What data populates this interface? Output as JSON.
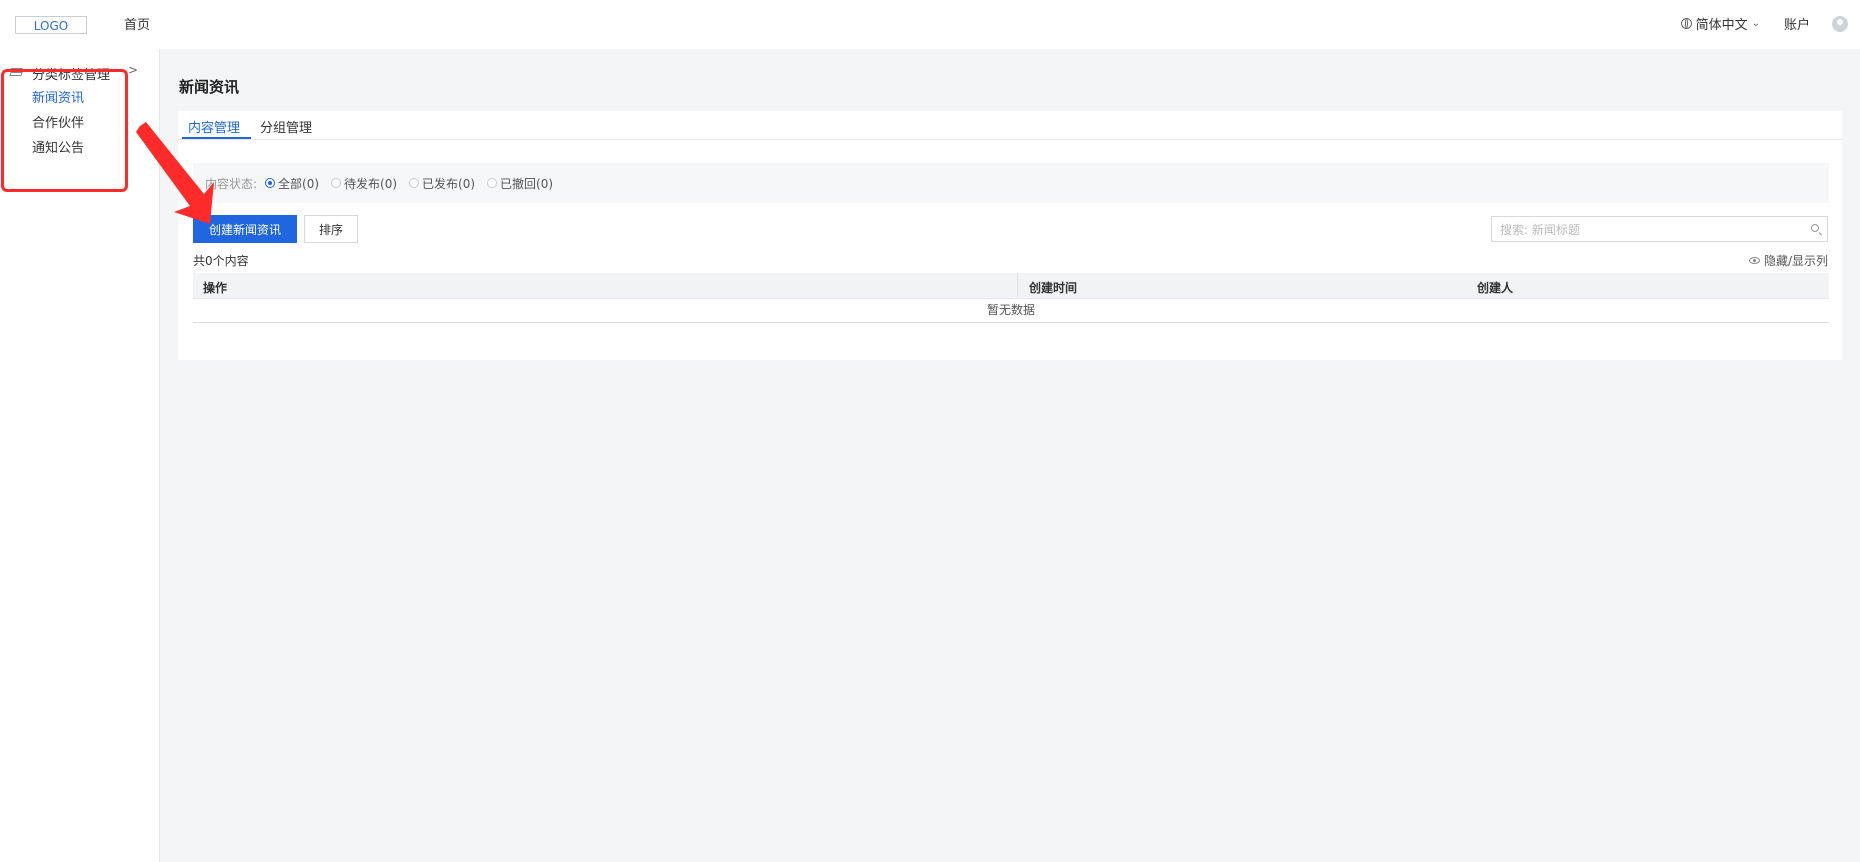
{
  "header": {
    "logo": "LOGO",
    "nav_home": "首页",
    "language": "简体中文",
    "account": "账户"
  },
  "sidebar": {
    "group_label": "分类标签管理",
    "items": [
      {
        "label": "新闻资讯",
        "active": true
      },
      {
        "label": "合作伙伴",
        "active": false
      },
      {
        "label": "通知公告",
        "active": false
      }
    ]
  },
  "main": {
    "title": "新闻资讯",
    "tabs": [
      {
        "label": "内容管理",
        "active": true
      },
      {
        "label": "分组管理",
        "active": false
      }
    ],
    "filter": {
      "label": "内容状态:",
      "options": [
        {
          "label": "全部(0)",
          "checked": true
        },
        {
          "label": "待发布(0)",
          "checked": false
        },
        {
          "label": "已发布(0)",
          "checked": false
        },
        {
          "label": "已撤回(0)",
          "checked": false
        }
      ]
    },
    "create_button": "创建新闻资讯",
    "sort_button": "排序",
    "search_placeholder": "搜索: 新闻标题",
    "count_text": "共0个内容",
    "toggle_columns": "隐藏/显示列",
    "table": {
      "columns": [
        "操作",
        "创建时间",
        "创建人"
      ],
      "empty_text": "暂无数据"
    }
  },
  "colors": {
    "accent": "#1f66e0",
    "annotation": "#ff2a2a"
  }
}
